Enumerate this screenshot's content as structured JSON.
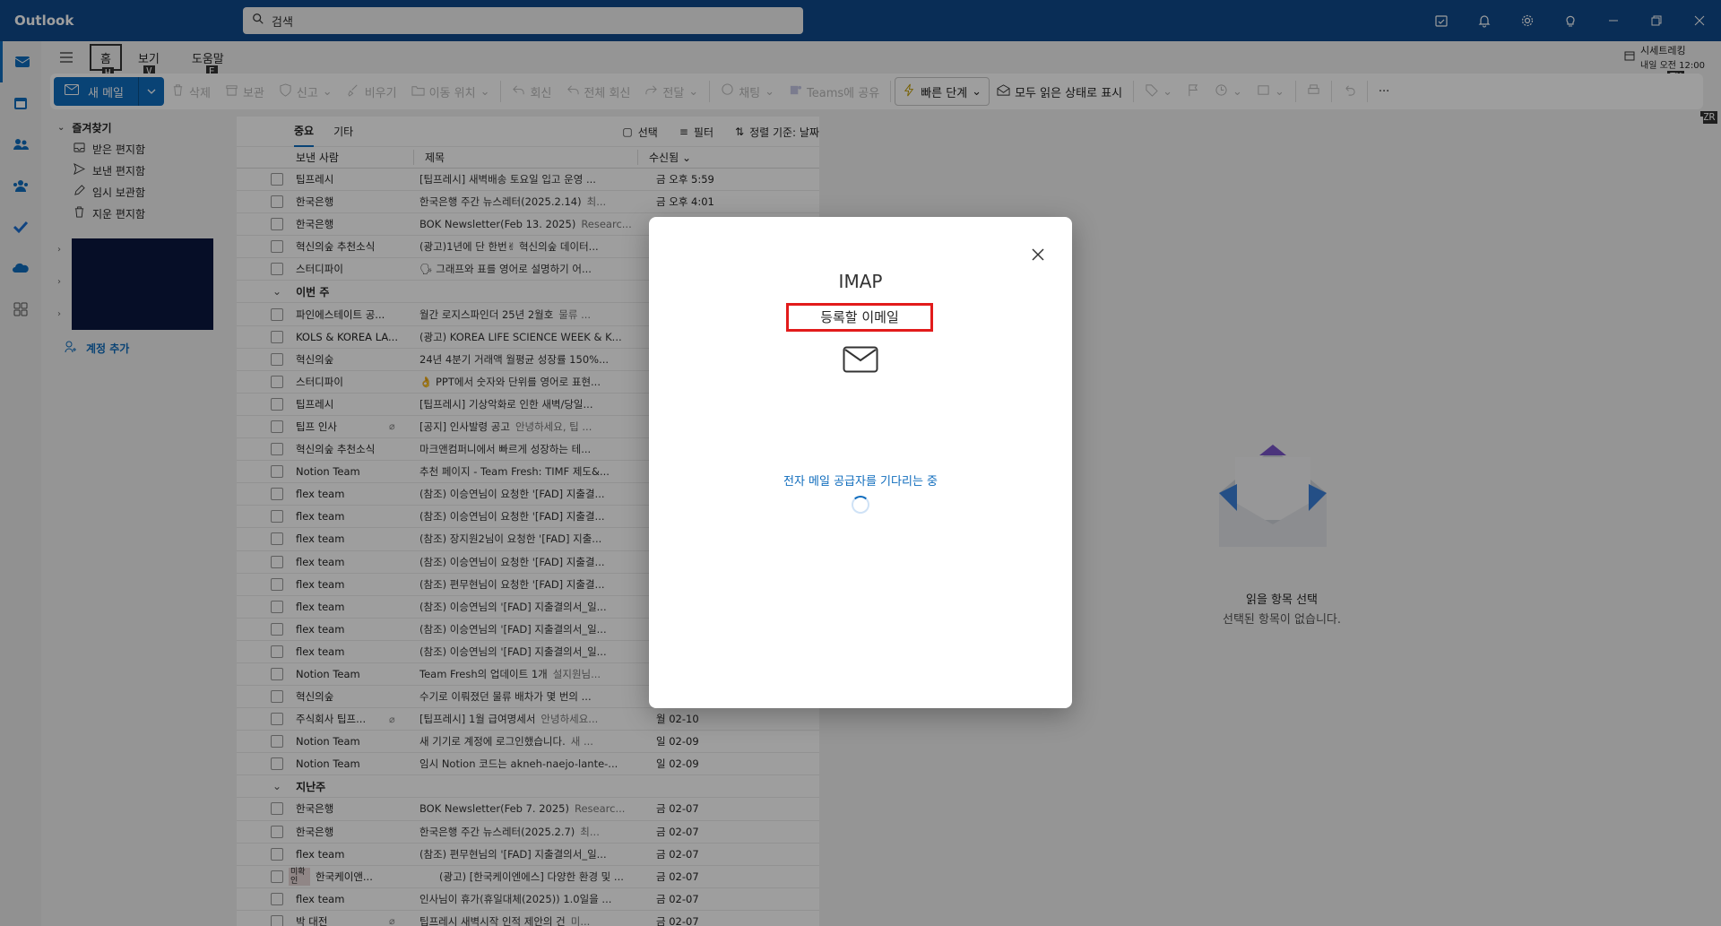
{
  "app": {
    "name": "Outlook"
  },
  "search": {
    "placeholder": "검색"
  },
  "ribbon_tabs": [
    {
      "label": "홈",
      "keytip": "H"
    },
    {
      "label": "보기",
      "keytip": "V"
    },
    {
      "label": "도움말",
      "keytip": "E"
    }
  ],
  "ribbon": {
    "new_mail": "새 메일",
    "delete": "삭제",
    "archive": "보관",
    "report": "신고",
    "sweep": "비우기",
    "move_to": "이동 위치",
    "reply": "회신",
    "reply_all": "전체 회신",
    "forward": "전달",
    "chat": "채팅",
    "teams_share": "Teams에 공유",
    "quick_steps": "빠른 단계",
    "mark_all_read": "모두 읽은 상태로 표시",
    "more": "···"
  },
  "reminder": {
    "title": "시세트레킹",
    "time": "내일 오전 12:00",
    "keytip": "TU"
  },
  "side_keytip": "ZR",
  "folders": {
    "favorites": "즐겨찾기",
    "items": [
      "받은 편지함",
      "보낸 편지함",
      "임시 보관함",
      "지운 편지함"
    ],
    "add_account": "계정 추가"
  },
  "message_list": {
    "tabs": [
      "중요",
      "기타"
    ],
    "tools": {
      "select": "선택",
      "filter": "필터",
      "sort": "정렬 기준: 날짜"
    },
    "columns": {
      "sender": "보낸 사람",
      "subject": "제목",
      "received": "수신됨"
    },
    "groups": {
      "this_week": "이번 주",
      "last_week": "지난주"
    },
    "rows_top": [
      {
        "sender": "팁프레시",
        "subject": "[팁프레시] 새벽배송 토요일 입고 운영 ...",
        "date": "금 오후 5:59"
      },
      {
        "sender": "한국은행",
        "subject": "한국은행 주간 뉴스레터(2025.2.14)",
        "preview": "최...",
        "date": "금 오후 4:01"
      },
      {
        "sender": "한국은행",
        "subject": "BOK Newsletter(Feb 13. 2025)",
        "preview": "Researc..."
      },
      {
        "sender": "혁신의숲 추천소식",
        "subject": "(광고)1년에 단 한번✌ 혁신의숲 데이터..."
      },
      {
        "sender": "스터디파이",
        "subject": "🗣 그래프와 표를 영어로 설명하기 어..."
      }
    ],
    "rows_week": [
      {
        "sender": "파인에스테이트 공...",
        "subject": "월간 로지스파인더 25년 2월호",
        "preview": "물류 ..."
      },
      {
        "sender": "KOLS & KOREA LA...",
        "subject": "(광고) KOREA LIFE SCIENCE WEEK & K..."
      },
      {
        "sender": "혁신의숲",
        "subject": "24년 4분기 거래액 월평균 성장률 150%..."
      },
      {
        "sender": "스터디파이",
        "subject": "👌 PPT에서 숫자와 단위를 영어로 표현..."
      },
      {
        "sender": "팁프레시",
        "subject": "[팁프레시] 기상악화로 인한 새벽/당일..."
      },
      {
        "sender": "팁프 인사",
        "subject": "[공지] 인사발령 공고",
        "preview": "안녕하세요, 팁 ...",
        "attach": true
      },
      {
        "sender": "혁신의숲 추천소식",
        "subject": "마크앤컴퍼니에서 빠르게 성장하는 테..."
      },
      {
        "sender": "Notion Team",
        "subject": "추천 페이지 - Team Fresh: TIMF 제도&..."
      },
      {
        "sender": "flex team",
        "subject": "(참조) 이승연님이 요청한 '[FAD] 지출결..."
      },
      {
        "sender": "flex team",
        "subject": "(참조) 이승연님이 요청한 '[FAD] 지출결..."
      },
      {
        "sender": "flex team",
        "subject": "(참조) 장지원2님이 요청한 '[FAD] 지출..."
      },
      {
        "sender": "flex team",
        "subject": "(참조) 이승연님이 요청한 '[FAD] 지출결..."
      },
      {
        "sender": "flex team",
        "subject": "(참조) 편무현님이 요청한 '[FAD] 지출결..."
      },
      {
        "sender": "flex team",
        "subject": "(참조) 이승연님의 '[FAD] 지출결의서_일..."
      },
      {
        "sender": "flex team",
        "subject": "(참조) 이승연님의 '[FAD] 지출결의서_일..."
      },
      {
        "sender": "flex team",
        "subject": "(참조) 이승연님의 '[FAD] 지출결의서_일..."
      },
      {
        "sender": "Notion Team",
        "subject": "Team Fresh의 업데이트 1개",
        "preview": "설지원님..."
      },
      {
        "sender": "혁신의숲",
        "subject": "수기로 이뤄졌던 물류 배차가 몇 번의 ..."
      },
      {
        "sender": "주식회사 팁프...",
        "subject": "[팁프레시] 1월 급여명세서",
        "preview": "안녕하세요...",
        "date": "월 02-10",
        "attach": true
      },
      {
        "sender": "Notion Team",
        "subject": "새 기기로 계정에 로그인했습니다.",
        "preview": "새 ...",
        "date": "일 02-09"
      },
      {
        "sender": "Notion Team",
        "subject": "임시 Notion 코드는 akneh-naejo-lante-...",
        "date": "일 02-09"
      }
    ],
    "rows_last": [
      {
        "sender": "한국은행",
        "subject": "BOK Newsletter(Feb 7. 2025)",
        "preview": "Researc...",
        "date": "금 02-07"
      },
      {
        "sender": "한국은행",
        "subject": "한국은행 주간 뉴스레터(2025.2.7)",
        "preview": "최...",
        "date": "금 02-07"
      },
      {
        "sender": "flex team",
        "subject": "(참조) 편무현님의 '[FAD] 지출결의서_일...",
        "date": "금 02-07"
      },
      {
        "sender": "한국케이앤...",
        "subject": "(광고) [한국케이엔에스] 다양한 환경 및 ...",
        "date": "금 02-07",
        "badge": "미확인"
      },
      {
        "sender": "flex team",
        "subject": "인사님이 휴가(휴일대체(2025)) 1.0일을 ...",
        "date": "금 02-07"
      },
      {
        "sender": "박 대전",
        "subject": "팁프레시 새벽시작 인적 제안의 건",
        "preview": "미...",
        "date": "금 02-07",
        "attach": true
      }
    ]
  },
  "reading_pane": {
    "title": "읽을 항목 선택",
    "subtitle": "선택된 항목이 없습니다."
  },
  "dialog": {
    "title": "IMAP",
    "email": "등록할 이메일",
    "status": "전자 메일 공급자를 기다리는 중"
  }
}
